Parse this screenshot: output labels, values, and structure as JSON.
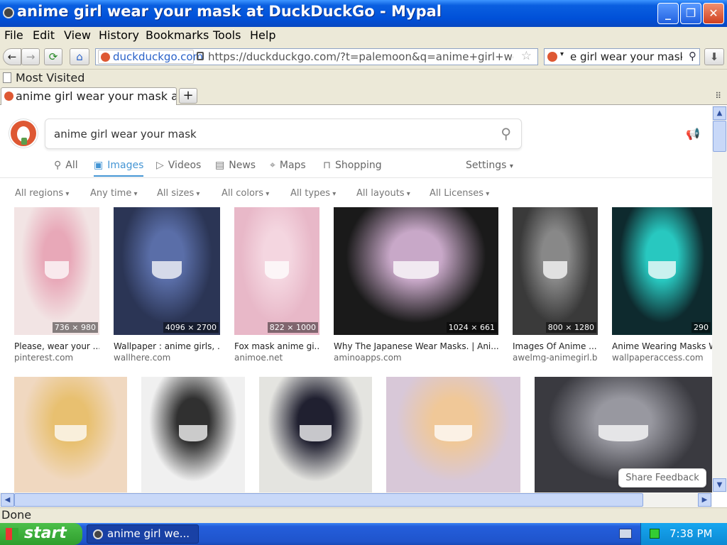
{
  "window": {
    "title": "anime girl wear your mask at DuckDuckGo - Mypal",
    "minimize": "_",
    "maximize": "❐",
    "close": "✕"
  },
  "menu": [
    "File",
    "Edit",
    "View",
    "History",
    "Bookmarks",
    "Tools",
    "Help"
  ],
  "nav": {
    "back": "←",
    "forward": "→",
    "reload": "⟳",
    "home": "⌂",
    "domain": "duckduckgo.com",
    "url": "https://duckduckgo.com/?t=palemoon&q=anime+girl+wear",
    "search_value": "e girl wear your mask",
    "download": "⬇"
  },
  "bookmarks": {
    "label": "Most Visited"
  },
  "tab": {
    "label": "anime girl wear your mask at...",
    "new": "+"
  },
  "search": {
    "query": "anime girl wear your mask"
  },
  "search_tabs": [
    {
      "label": "All",
      "icon": "search-icon"
    },
    {
      "label": "Images",
      "icon": "image-icon"
    },
    {
      "label": "Videos",
      "icon": "play-icon"
    },
    {
      "label": "News",
      "icon": "news-icon"
    },
    {
      "label": "Maps",
      "icon": "pin-icon"
    },
    {
      "label": "Shopping",
      "icon": "bag-icon"
    }
  ],
  "settings": "Settings",
  "filters": [
    "All regions",
    "Any time",
    "All sizes",
    "All colors",
    "All types",
    "All layouts",
    "All Licenses"
  ],
  "results_row1": [
    {
      "dim": "736 × 980",
      "caption": "Please, wear your ...",
      "source": "pinterest.com",
      "bg": "#f2e4e4",
      "fg": "#e8a8b8"
    },
    {
      "dim": "4096 × 2700",
      "caption": "Wallpaper : anime girls, ...",
      "source": "wallhere.com",
      "bg": "#2b3555",
      "fg": "#5a6ea8"
    },
    {
      "dim": "822 × 1000",
      "caption": "Fox mask anime gi...",
      "source": "animoe.net",
      "bg": "#e8b8c8",
      "fg": "#f4d6e0"
    },
    {
      "dim": "1024 × 661",
      "caption": "Why The Japanese Wear Masks. | Ani...",
      "source": "aminoapps.com",
      "bg": "#1a1a1a",
      "fg": "#c8a8c8"
    },
    {
      "dim": "800 × 1280",
      "caption": "Images Of Anime ...",
      "source": "awelmg-animegirl.b...",
      "bg": "#3a3a3a",
      "fg": "#888888"
    },
    {
      "dim": "290",
      "caption": "Anime Wearing Masks W",
      "source": "wallpaperaccess.com",
      "bg": "#0e2a2e",
      "fg": "#28c8c0"
    }
  ],
  "results_row2": [
    {
      "bg": "#f0d8c0",
      "fg": "#e8c070"
    },
    {
      "bg": "#f0f0f0",
      "fg": "#303030"
    },
    {
      "bg": "#e4e4e0",
      "fg": "#202030"
    },
    {
      "bg": "#d8c8d8",
      "fg": "#f0c898"
    },
    {
      "bg": "#3a3a40",
      "fg": "#9898a0"
    }
  ],
  "feedback": "Share Feedback",
  "status": "Done",
  "taskbar": {
    "start": "start",
    "item": "anime girl we...",
    "clock": "7:38 PM"
  }
}
